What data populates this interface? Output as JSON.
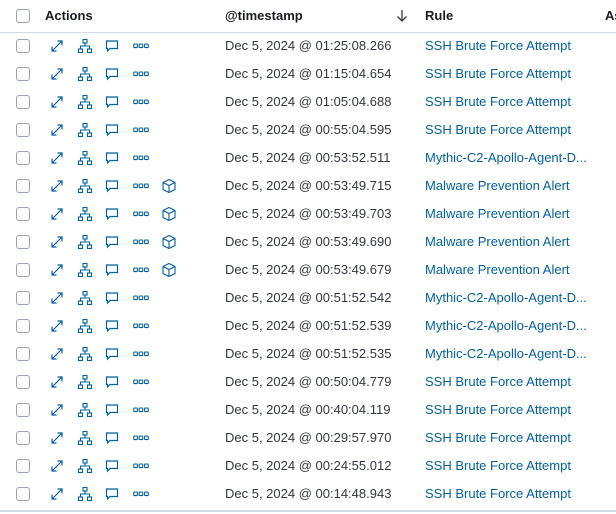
{
  "header": {
    "actions_label": "Actions",
    "timestamp_label": "@timestamp",
    "rule_label": "Rule",
    "next_label": "As"
  },
  "colors": {
    "link": "#0061a6",
    "icon": "#0061a6",
    "border": "#d3dae6"
  },
  "icons": [
    "expand-icon",
    "analyze-graph-icon",
    "comment-icon",
    "more-actions-icon",
    "session-view-icon"
  ],
  "rows": [
    {
      "timestamp": "Dec 5, 2024 @ 01:25:08.266",
      "rule": "SSH Brute Force Attempt",
      "session": false
    },
    {
      "timestamp": "Dec 5, 2024 @ 01:15:04.654",
      "rule": "SSH Brute Force Attempt",
      "session": false
    },
    {
      "timestamp": "Dec 5, 2024 @ 01:05:04.688",
      "rule": "SSH Brute Force Attempt",
      "session": false
    },
    {
      "timestamp": "Dec 5, 2024 @ 00:55:04.595",
      "rule": "SSH Brute Force Attempt",
      "session": false
    },
    {
      "timestamp": "Dec 5, 2024 @ 00:53:52.511",
      "rule": "Mythic-C2-Apollo-Agent-D...",
      "session": false
    },
    {
      "timestamp": "Dec 5, 2024 @ 00:53:49.715",
      "rule": "Malware Prevention Alert",
      "session": true
    },
    {
      "timestamp": "Dec 5, 2024 @ 00:53:49.703",
      "rule": "Malware Prevention Alert",
      "session": true
    },
    {
      "timestamp": "Dec 5, 2024 @ 00:53:49.690",
      "rule": "Malware Prevention Alert",
      "session": true
    },
    {
      "timestamp": "Dec 5, 2024 @ 00:53:49.679",
      "rule": "Malware Prevention Alert",
      "session": true
    },
    {
      "timestamp": "Dec 5, 2024 @ 00:51:52.542",
      "rule": "Mythic-C2-Apollo-Agent-D...",
      "session": false
    },
    {
      "timestamp": "Dec 5, 2024 @ 00:51:52.539",
      "rule": "Mythic-C2-Apollo-Agent-D...",
      "session": false
    },
    {
      "timestamp": "Dec 5, 2024 @ 00:51:52.535",
      "rule": "Mythic-C2-Apollo-Agent-D...",
      "session": false
    },
    {
      "timestamp": "Dec 5, 2024 @ 00:50:04.779",
      "rule": "SSH Brute Force Attempt",
      "session": false
    },
    {
      "timestamp": "Dec 5, 2024 @ 00:40:04.119",
      "rule": "SSH Brute Force Attempt",
      "session": false
    },
    {
      "timestamp": "Dec 5, 2024 @ 00:29:57.970",
      "rule": "SSH Brute Force Attempt",
      "session": false
    },
    {
      "timestamp": "Dec 5, 2024 @ 00:24:55.012",
      "rule": "SSH Brute Force Attempt",
      "session": false
    },
    {
      "timestamp": "Dec 5, 2024 @ 00:14:48.943",
      "rule": "SSH Brute Force Attempt",
      "session": false
    }
  ]
}
